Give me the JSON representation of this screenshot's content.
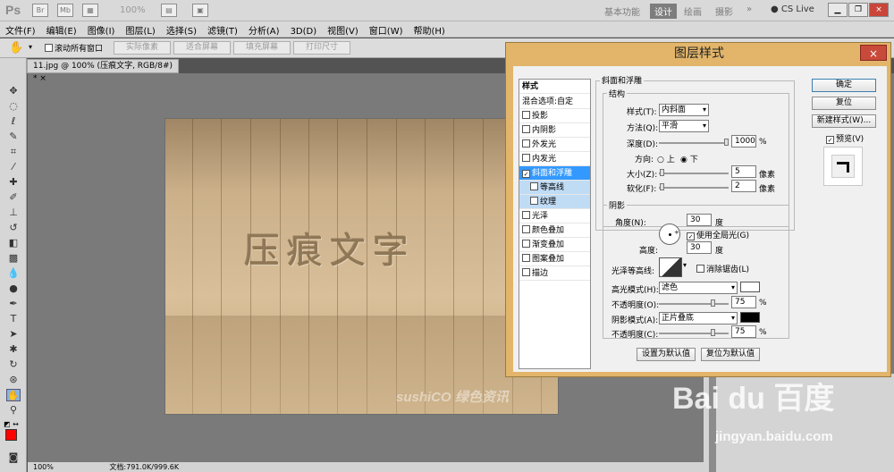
{
  "app": {
    "logo": "Ps",
    "zoom": "100%"
  },
  "workspace": {
    "items": [
      "基本功能",
      "设计",
      "绘画",
      "摄影"
    ],
    "more": "»",
    "cslive": "CS Live"
  },
  "menu": [
    "文件(F)",
    "编辑(E)",
    "图像(I)",
    "图层(L)",
    "选择(S)",
    "滤镜(T)",
    "分析(A)",
    "3D(D)",
    "视图(V)",
    "窗口(W)",
    "帮助(H)"
  ],
  "options": {
    "scroll_all": "滚动所有窗口",
    "buttons": [
      "实际像素",
      "适合屏幕",
      "填充屏幕",
      "打印尺寸"
    ]
  },
  "document": {
    "tab": "11.jpg @ 100% (压痕文字, RGB/8#) *",
    "close": "×",
    "text": "压痕文字",
    "watermark": "sushiCO 绿色资讯"
  },
  "status": {
    "zoom": "100%",
    "doc": "文档:791.0K/999.6K"
  },
  "watermark": {
    "logo": "Bai du 百度",
    "url": "jingyan.baidu.com"
  },
  "dialog": {
    "title": "图层样式",
    "close": "×",
    "styles_header": "样式",
    "styles": [
      {
        "label": "混合选项:自定",
        "check": false
      },
      {
        "label": "投影",
        "check": true,
        "checked": false
      },
      {
        "label": "内阴影",
        "check": true,
        "checked": false
      },
      {
        "label": "外发光",
        "check": true,
        "checked": false
      },
      {
        "label": "内发光",
        "check": true,
        "checked": false
      },
      {
        "label": "斜面和浮雕",
        "check": true,
        "checked": true
      },
      {
        "label": "等高线",
        "check": true,
        "checked": false
      },
      {
        "label": "纹理",
        "check": true,
        "checked": false
      },
      {
        "label": "光泽",
        "check": true,
        "checked": false
      },
      {
        "label": "颜色叠加",
        "check": true,
        "checked": false
      },
      {
        "label": "渐变叠加",
        "check": true,
        "checked": false
      },
      {
        "label": "图案叠加",
        "check": true,
        "checked": false
      },
      {
        "label": "描边",
        "check": true,
        "checked": false
      }
    ],
    "bevel": {
      "section": "斜面和浮雕",
      "structure": "结构",
      "style_label": "样式(T):",
      "style_value": "内斜面",
      "method_label": "方法(Q):",
      "method_value": "平滑",
      "depth_label": "深度(D):",
      "depth_value": "1000",
      "depth_unit": "%",
      "direction_label": "方向:",
      "dir_up": "上",
      "dir_down": "下",
      "size_label": "大小(Z):",
      "size_value": "5",
      "size_unit": "像素",
      "soften_label": "软化(F):",
      "soften_value": "2",
      "soften_unit": "像素"
    },
    "shading": {
      "section": "阴影",
      "angle_label": "角度(N):",
      "angle_value": "30",
      "angle_unit": "度",
      "global_light": "使用全局光(G)",
      "altitude_label": "高度:",
      "altitude_value": "30",
      "altitude_unit": "度",
      "gloss_label": "光泽等高线:",
      "antialias": "消除锯齿(L)",
      "highlight_label": "高光模式(H):",
      "highlight_value": "滤色",
      "highlight_color": "#ffffff",
      "hl_opacity_label": "不透明度(O):",
      "hl_opacity_value": "75",
      "pct": "%",
      "shadow_label": "阴影模式(A):",
      "shadow_value": "正片叠底",
      "shadow_color": "#000000",
      "sh_opacity_label": "不透明度(C):",
      "sh_opacity_value": "75"
    },
    "buttons": {
      "set_default": "设置为默认值",
      "reset_default": "复位为默认值",
      "ok": "确定",
      "reset": "复位",
      "new_style": "新建样式(W)...",
      "preview": "预览(V)"
    }
  }
}
